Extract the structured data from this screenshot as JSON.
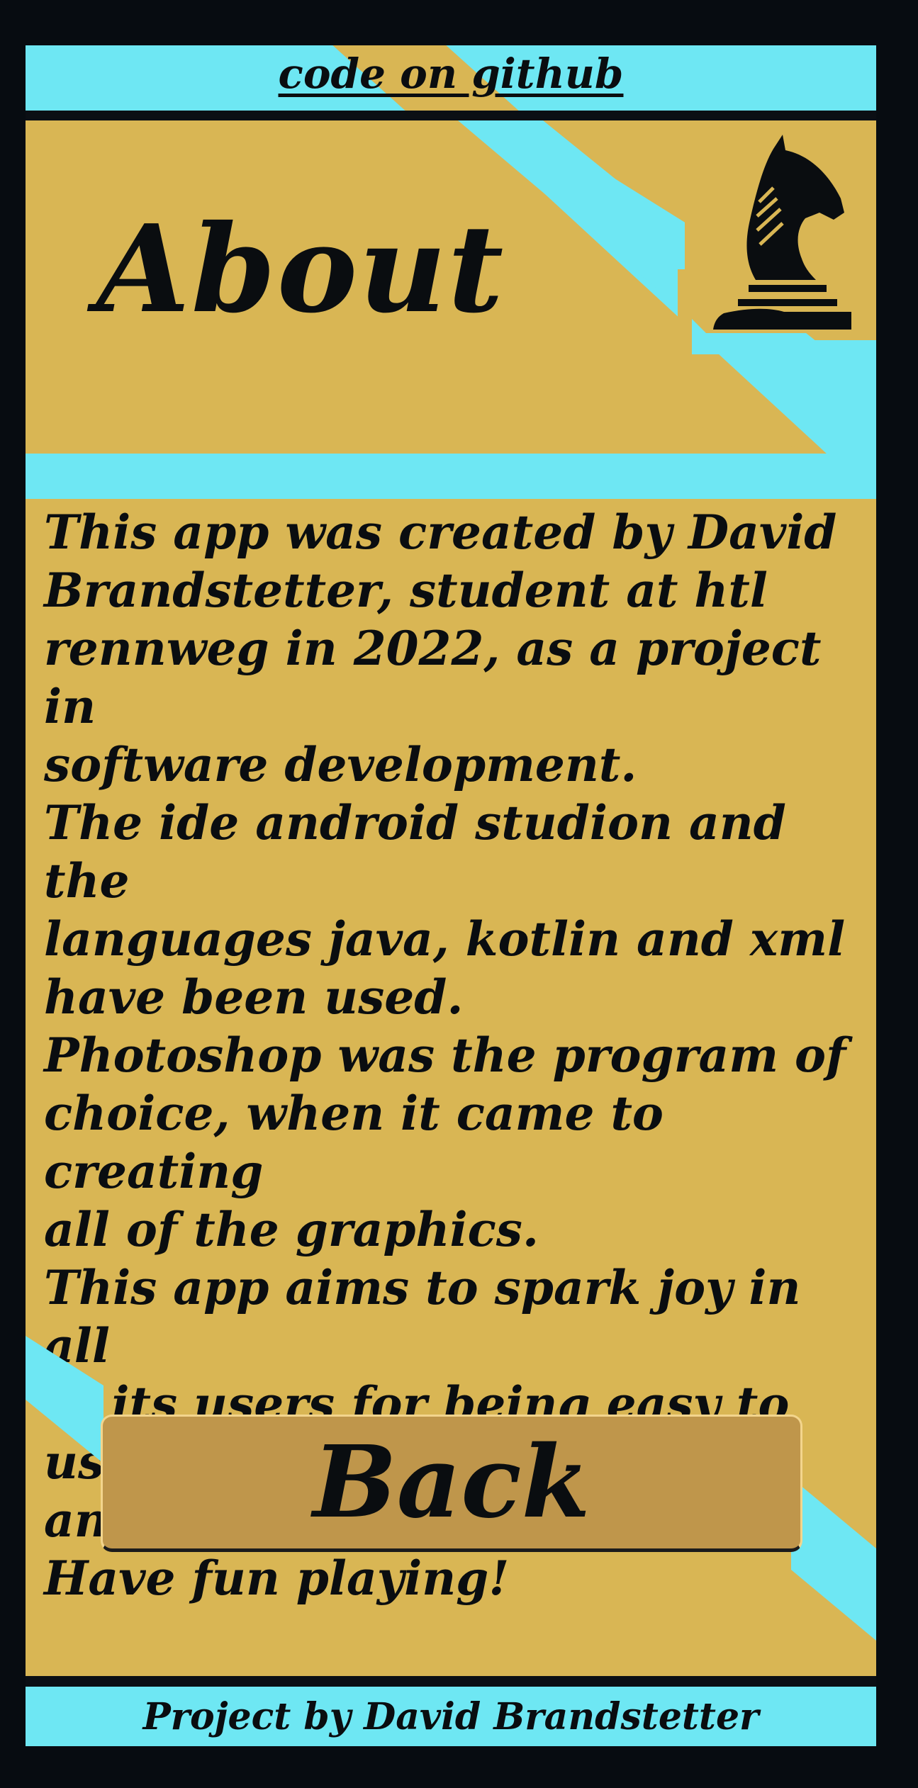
{
  "header": {
    "github_link": "code on github"
  },
  "title": "About",
  "logo_icon": "chess-knight-icon",
  "body_text": "This app was created by David\nBrandstetter, student at htl\nrennweg in 2022, as a project in\nsoftware development.\nThe ide android studion and the\nlanguages java, kotlin and xml\nhave been used.\nPhotoshop was the program of\nchoice, when it came to creating\nall of the graphics.\nThis app aims to spark joy in all\nof its users for being easy to use\nand neatly designed.\nHave fun playing!",
  "back_button": "Back",
  "footer": "Project by David Brandstetter",
  "colors": {
    "background": "#070c11",
    "gold": "#d9b654",
    "cyan": "#6ee7f3",
    "button": "#bf964b",
    "text": "#0a0d10"
  }
}
